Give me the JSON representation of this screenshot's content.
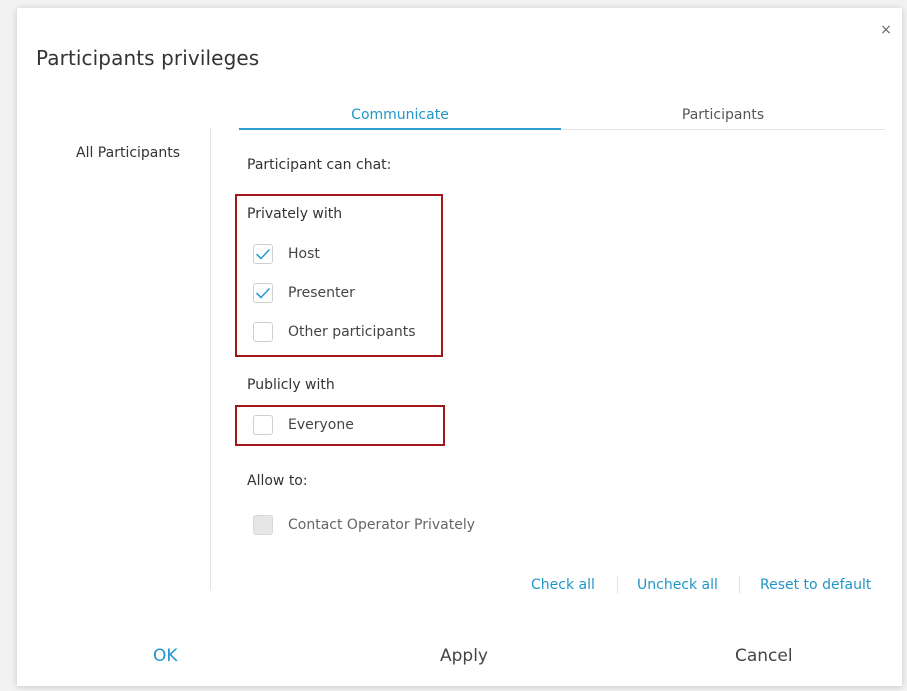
{
  "dialog": {
    "title": "Participants privileges",
    "close_glyph": "×"
  },
  "sidebar": {
    "items": [
      {
        "label": "All Participants"
      }
    ]
  },
  "tabs": [
    {
      "label": "Communicate",
      "active": true
    },
    {
      "label": "Participants",
      "active": false
    }
  ],
  "communicate": {
    "chat_heading": "Participant can chat:",
    "privately": {
      "heading": "Privately with",
      "options": [
        {
          "label": "Host",
          "checked": true
        },
        {
          "label": "Presenter",
          "checked": true
        },
        {
          "label": "Other participants",
          "checked": false
        }
      ]
    },
    "publicly": {
      "heading": "Publicly with",
      "options": [
        {
          "label": "Everyone",
          "checked": false
        }
      ]
    },
    "allow": {
      "heading": "Allow to:",
      "options": [
        {
          "label": "Contact Operator Privately",
          "checked": false,
          "disabled": true
        }
      ]
    }
  },
  "actions": {
    "check_all": "Check all",
    "uncheck_all": "Uncheck all",
    "reset_default": "Reset to default"
  },
  "footer": {
    "ok": "OK",
    "apply": "Apply",
    "cancel": "Cancel"
  },
  "colors": {
    "accent": "#2196c9",
    "highlight_border": "#a3161c",
    "check": "#2f9ed1"
  }
}
